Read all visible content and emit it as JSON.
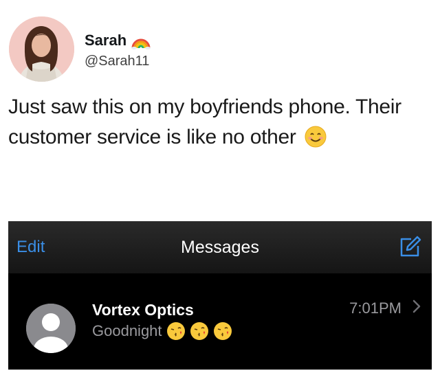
{
  "tweet": {
    "display_name": "Sarah",
    "handle": "@Sarah11",
    "text": "Just saw this on my boyfriends phone. Their customer service is like no other"
  },
  "messages_app": {
    "edit_label": "Edit",
    "title": "Messages",
    "conversations": [
      {
        "contact_name": "Vortex Optics",
        "preview": "Goodnight",
        "time": "7:01PM"
      }
    ]
  },
  "colors": {
    "accent_blue": "#3a8ee6",
    "nav_background": "#1f1f1f",
    "avatar_background": "#f3c9c3"
  },
  "icons": [
    "rainbow-icon",
    "smiling-face-icon",
    "compose-icon",
    "contact-avatar-icon",
    "kissing-face-icon",
    "chevron-right-icon"
  ]
}
